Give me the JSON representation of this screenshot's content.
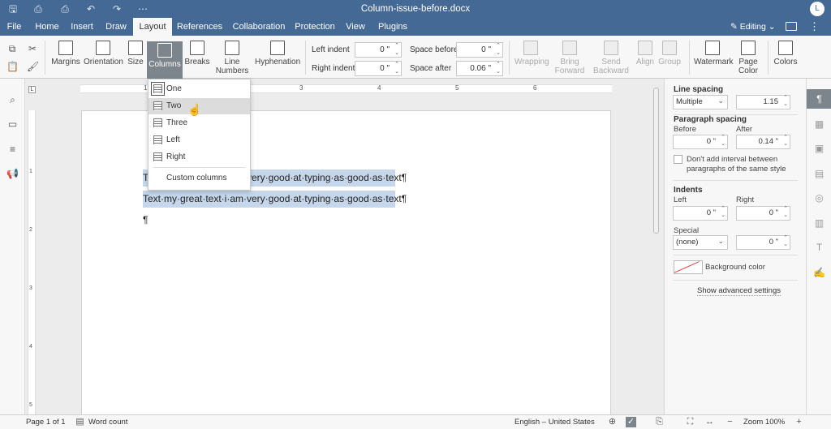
{
  "app": {
    "document_title": "Column-issue-before.docx",
    "user_initial": "L"
  },
  "titlebar_icons": [
    "save-icon",
    "print-icon",
    "quick-print-icon",
    "undo-icon",
    "redo-icon",
    "more-icon"
  ],
  "tabs": [
    {
      "label": "File",
      "active": false
    },
    {
      "label": "Home",
      "active": false
    },
    {
      "label": "Insert",
      "active": false
    },
    {
      "label": "Draw",
      "active": false
    },
    {
      "label": "Layout",
      "active": true
    },
    {
      "label": "References",
      "active": false
    },
    {
      "label": "Collaboration",
      "active": false
    },
    {
      "label": "Protection",
      "active": false
    },
    {
      "label": "View",
      "active": false
    },
    {
      "label": "Plugins",
      "active": false
    }
  ],
  "mode": {
    "label": "Editing"
  },
  "toolbar": {
    "margins": "Margins",
    "orientation": "Orientation",
    "size": "Size",
    "columns": "Columns",
    "breaks": "Breaks",
    "line_numbers": "Line\nNumbers",
    "hyphenation": "Hyphenation",
    "left_indent_label": "Left indent",
    "left_indent_value": "0 \"",
    "right_indent_label": "Right indent",
    "right_indent_value": "0 \"",
    "space_before_label": "Space before",
    "space_before_value": "0 \"",
    "space_after_label": "Space after",
    "space_after_value": "0.06 \"",
    "wrapping": "Wrapping",
    "bring_forward": "Bring\nForward",
    "send_backward": "Send\nBackward",
    "align": "Align",
    "group": "Group",
    "watermark": "Watermark",
    "page_color": "Page\nColor",
    "colors": "Colors"
  },
  "columns_menu": {
    "items": [
      {
        "label": "One",
        "selected": true
      },
      {
        "label": "Two",
        "hovered": true
      },
      {
        "label": "Three"
      },
      {
        "label": "Left"
      },
      {
        "label": "Right"
      }
    ],
    "custom": "Custom columns"
  },
  "ruler": {
    "h_numbers": [
      "1",
      "2",
      "3",
      "4",
      "5",
      "6"
    ],
    "v_numbers": [
      "1",
      "2",
      "3",
      "4",
      "5"
    ],
    "tab_marker": "L"
  },
  "document": {
    "line1": "Text·my·great·text·i·am·very·good·at·typing·as·good·as·text¶",
    "line2": "Text·my·great·text·i·am·very·good·at·typing·as·good·as·text¶",
    "line3": "¶"
  },
  "panel": {
    "line_spacing_title": "Line spacing",
    "line_spacing_mode": "Multiple",
    "line_spacing_value": "1.15",
    "paragraph_spacing_title": "Paragraph spacing",
    "before_label": "Before",
    "before_value": "0 \"",
    "after_label": "After",
    "after_value": "0.14 \"",
    "dont_add_interval": "Don't add interval between paragraphs of the same style",
    "indents_title": "Indents",
    "left_label": "Left",
    "left_value": "0 \"",
    "right_label": "Right",
    "right_value": "0 \"",
    "special_label": "Special",
    "special_value": "(none)",
    "special_amount": "0 \"",
    "background_color": "Background color",
    "advanced": "Show advanced settings"
  },
  "right_rail_icons": [
    "paragraph-icon",
    "table-icon",
    "image-icon",
    "header-footer-icon",
    "shape-icon",
    "chart-icon",
    "text-art-icon",
    "signature-icon"
  ],
  "status": {
    "page": "Page 1 of 1",
    "word_count": "Word count",
    "language": "English – United States",
    "zoom": "Zoom 100%"
  },
  "colors": {
    "title_bar": "#446995",
    "selection": "#c6d7ec",
    "active_button": "#7d858c"
  }
}
